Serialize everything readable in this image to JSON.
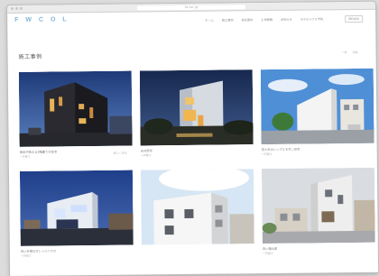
{
  "browser": {
    "url": "fw.co.jp"
  },
  "header": {
    "logo": "F W C O L",
    "nav": [
      "ホーム",
      "施工事例",
      "会社案内",
      "土地情報",
      "お知らせ",
      "モデルハウス予約"
    ],
    "button": "資料請求"
  },
  "page": {
    "title": "施工事例",
    "toggles": [
      "一覧",
      "地図"
    ]
  },
  "projects": [
    {
      "title": "夜景が映える3階建ての住宅",
      "sub": "一戸建て",
      "tag": "詳しく見る"
    },
    {
      "title": "光の邸宅",
      "sub": "一戸建て",
      "tag": ""
    },
    {
      "title": "空と白のシンプルモダン住宅",
      "sub": "一戸建て",
      "tag": ""
    },
    {
      "title": "白い外壁のガレージハウス",
      "sub": "一戸建て",
      "tag": ""
    },
    {
      "title": "",
      "sub": "",
      "tag": ""
    },
    {
      "title": "白い箱の家",
      "sub": "一戸建て",
      "tag": ""
    }
  ]
}
